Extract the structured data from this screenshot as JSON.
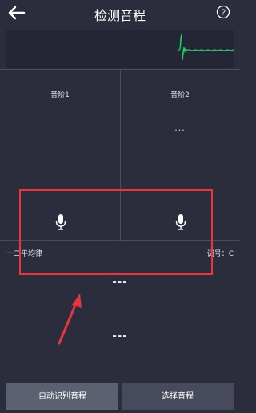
{
  "header": {
    "title": "检测音程",
    "back_icon": "back-arrow-icon",
    "help_icon": "question-mark-icon",
    "help_glyph": "?"
  },
  "scales": [
    {
      "label": "音阶1",
      "value": ""
    },
    {
      "label": "音阶2",
      "value": "..."
    }
  ],
  "mic_icon": "microphone-icon",
  "info": {
    "temperament": "十二平均律",
    "key": "调号：C"
  },
  "results": {
    "line1": "---",
    "line2": "---"
  },
  "buttons": {
    "auto_detect": "自动识别音程",
    "select": "选择音程"
  },
  "colors": {
    "background": "#2b2d3d",
    "waveform": "#2ecc71",
    "highlight": "#e6373e",
    "button_primary": "#5c6171",
    "button_secondary": "#464a5c"
  }
}
